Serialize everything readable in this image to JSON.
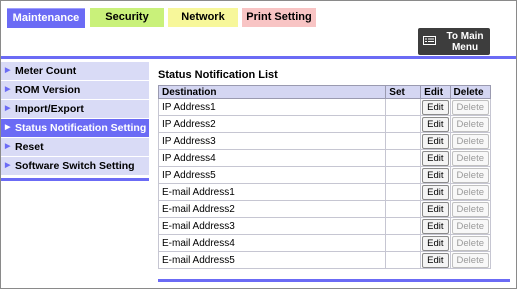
{
  "tabs": [
    {
      "label": "Maintenance"
    },
    {
      "label": "Security"
    },
    {
      "label": "Network"
    },
    {
      "label": "Print Setting"
    }
  ],
  "to_main": {
    "label": "To Main Menu"
  },
  "sidebar": {
    "items": [
      {
        "label": "Meter Count"
      },
      {
        "label": "ROM Version"
      },
      {
        "label": "Import/Export"
      },
      {
        "label": "Status Notification Setting"
      },
      {
        "label": "Reset"
      },
      {
        "label": "Software Switch Setting"
      }
    ],
    "active_index": 3
  },
  "main": {
    "title": "Status Notification List",
    "columns": [
      "Destination",
      "Set",
      "Edit",
      "Delete"
    ],
    "rows": [
      {
        "destination": "IP Address1",
        "set": "",
        "edit": "Edit",
        "delete": "Delete"
      },
      {
        "destination": "IP Address2",
        "set": "",
        "edit": "Edit",
        "delete": "Delete"
      },
      {
        "destination": "IP Address3",
        "set": "",
        "edit": "Edit",
        "delete": "Delete"
      },
      {
        "destination": "IP Address4",
        "set": "",
        "edit": "Edit",
        "delete": "Delete"
      },
      {
        "destination": "IP Address5",
        "set": "",
        "edit": "Edit",
        "delete": "Delete"
      },
      {
        "destination": "E-mail Address1",
        "set": "",
        "edit": "Edit",
        "delete": "Delete"
      },
      {
        "destination": "E-mail Address2",
        "set": "",
        "edit": "Edit",
        "delete": "Delete"
      },
      {
        "destination": "E-mail Address3",
        "set": "",
        "edit": "Edit",
        "delete": "Delete"
      },
      {
        "destination": "E-mail Address4",
        "set": "",
        "edit": "Edit",
        "delete": "Delete"
      },
      {
        "destination": "E-mail Address5",
        "set": "",
        "edit": "Edit",
        "delete": "Delete"
      }
    ]
  },
  "colors": {
    "accent": "#6b6bf5",
    "sidebar_bg": "#d9dbf6",
    "header_bg": "#d4d6f2"
  },
  "icons": {
    "to_main": "menu-screen-icon",
    "sidebar_arrow": "triangle-right-icon"
  }
}
